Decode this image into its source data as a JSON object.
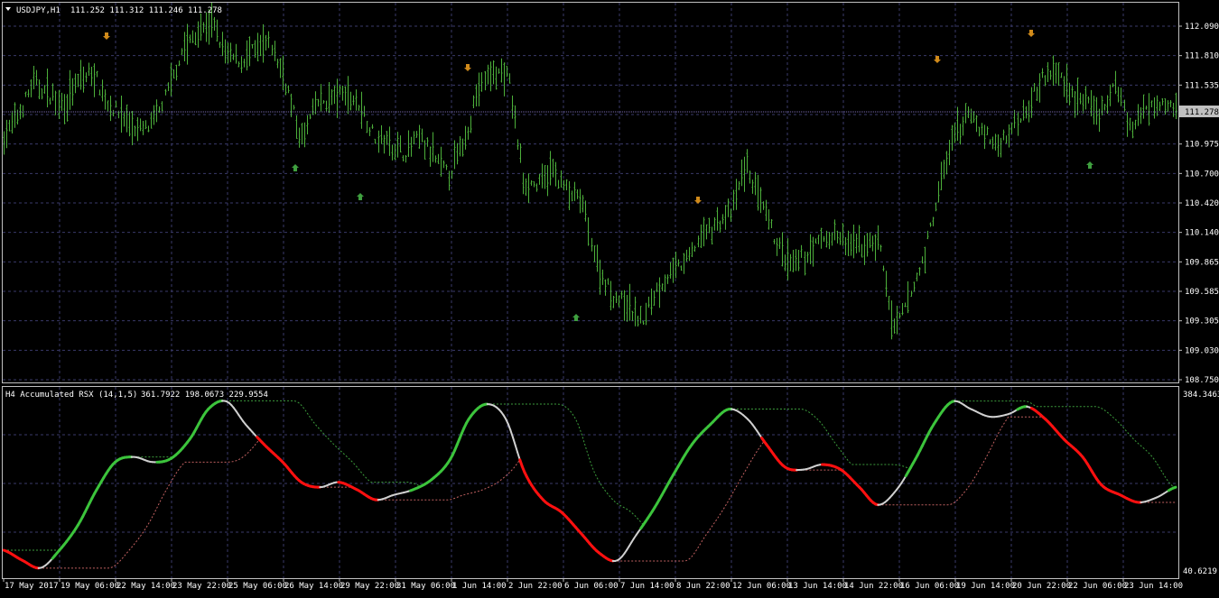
{
  "main_panel": {
    "title": "USDJPY,H1",
    "ohlc": "111.252 111.312 111.246 111.278",
    "current_price": "111.278",
    "price_labels": [
      "112.090",
      "111.810",
      "111.535",
      "111.278",
      "110.975",
      "110.700",
      "110.420",
      "110.140",
      "109.865",
      "109.585",
      "109.305",
      "109.030",
      "108.750"
    ],
    "colors": {
      "bars": "#4caf3a",
      "grid": "#3a3a6a",
      "frame": "#c0c0c0",
      "up_arrow": "#3f9f3f",
      "down_arrow": "#d08a1a",
      "price_marker": "#c0c0c0"
    },
    "arrow_icons": {
      "up": "up-arrow-icon",
      "down": "down-arrow-icon"
    }
  },
  "indicator_panel": {
    "title": "H4 Accumulated RSX (14,1,5)",
    "values": "361.7922 198.0673 229.9554",
    "y_max_label": "384.3463",
    "y_min_label": "40.6219",
    "colors": {
      "rsx_neutral": "#d0d0d0",
      "rsx_up": "#3cc43c",
      "rsx_down": "#ff1010",
      "upper_band": "#3c9c3c",
      "lower_band": "#c06060"
    }
  },
  "time_axis": {
    "labels": [
      "17 May 2017",
      "19 May 06:00",
      "22 May 14:00",
      "23 May 22:00",
      "25 May 06:00",
      "26 May 14:00",
      "29 May 22:00",
      "31 May 06:00",
      "1 Jun 14:00",
      "2 Jun 22:00",
      "6 Jun 06:00",
      "7 Jun 14:00",
      "8 Jun 22:00",
      "12 Jun 06:00",
      "13 Jun 14:00",
      "14 Jun 22:00",
      "16 Jun 06:00",
      "19 Jun 14:00",
      "20 Jun 22:00",
      "22 Jun 06:00",
      "23 Jun 14:00"
    ]
  },
  "chart_data": {
    "type": "line",
    "series": [
      {
        "name": "USDJPY,H1",
        "y": [
          111.0,
          111.2,
          111.5,
          111.4,
          111.3,
          111.5,
          111.6,
          111.3,
          111.2,
          111.05,
          111.1,
          111.4,
          111.8,
          111.95,
          112.05,
          111.75,
          111.7,
          111.8,
          111.85,
          111.5,
          110.95,
          111.3,
          111.35,
          111.4,
          111.3,
          111.0,
          110.95,
          110.85,
          111.0,
          110.8,
          110.65,
          110.95,
          111.45,
          111.6,
          111.55,
          110.6,
          110.55,
          110.7,
          110.5,
          110.4,
          109.8,
          109.55,
          109.45,
          109.3,
          109.6,
          109.75,
          109.85,
          110.1,
          110.2,
          110.3,
          110.75,
          110.4,
          110.05,
          109.8,
          109.9,
          110.05,
          110.1,
          110.0,
          110.0,
          110.05,
          109.2,
          109.5,
          109.9,
          110.5,
          111.0,
          111.2,
          111.05,
          110.9,
          111.1,
          111.3,
          111.55,
          111.6,
          111.4,
          111.3,
          111.2,
          111.5,
          111.05,
          111.3,
          111.35,
          111.28
        ]
      },
      {
        "name": "H4 Accumulated RSX (14,1,5)",
        "y": [
          80,
          60,
          45,
          80,
          130,
          200,
          255,
          265,
          255,
          262,
          300,
          360,
          375,
          330,
          290,
          255,
          215,
          205,
          215,
          200,
          180,
          190,
          200,
          220,
          260,
          340,
          370,
          340,
          235,
          180,
          155,
          115,
          75,
          60,
          110,
          165,
          230,
          290,
          330,
          360,
          340,
          290,
          245,
          240,
          250,
          240,
          205,
          170,
          200,
          260,
          330,
          375,
          360,
          345,
          350,
          365,
          340,
          300,
          265,
          210,
          190,
          175,
          185,
          205
        ]
      }
    ]
  }
}
